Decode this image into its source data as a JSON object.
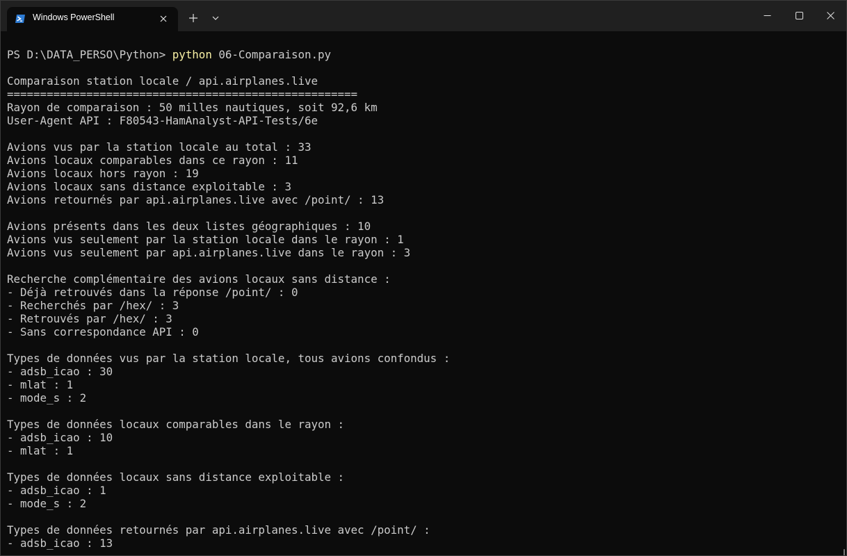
{
  "window": {
    "tab_title": "Windows PowerShell",
    "icons": {
      "tab": "powershell-icon",
      "close_tab": "close-icon",
      "new_tab": "plus-icon",
      "dropdown": "chevron-down-icon",
      "minimize": "minimize-icon",
      "maximize": "maximize-icon",
      "close": "close-icon"
    },
    "colors": {
      "titlebar": "#202020",
      "background": "#0c0c0c",
      "text": "#cccccc",
      "command": "#f9f1a5",
      "powershell_icon": "#2d7bd4"
    }
  },
  "terminal": {
    "prompt": "PS D:\\DATA_PERSO\\Python> ",
    "command": "python",
    "argument": " 06-Comparaison.py",
    "lines": [
      "",
      "Comparaison station locale / api.airplanes.live",
      "=====================================================",
      "Rayon de comparaison : 50 milles nautiques, soit 92,6 km",
      "User-Agent API : F80543-HamAnalyst-API-Tests/6e",
      "",
      "Avions vus par la station locale au total : 33",
      "Avions locaux comparables dans ce rayon : 11",
      "Avions locaux hors rayon : 19",
      "Avions locaux sans distance exploitable : 3",
      "Avions retournés par api.airplanes.live avec /point/ : 13",
      "",
      "Avions présents dans les deux listes géographiques : 10",
      "Avions vus seulement par la station locale dans le rayon : 1",
      "Avions vus seulement par api.airplanes.live dans le rayon : 3",
      "",
      "Recherche complémentaire des avions locaux sans distance :",
      "- Déjà retrouvés dans la réponse /point/ : 0",
      "- Recherchés par /hex/ : 3",
      "- Retrouvés par /hex/ : 3",
      "- Sans correspondance API : 0",
      "",
      "Types de données vus par la station locale, tous avions confondus :",
      "- adsb_icao : 30",
      "- mlat : 1",
      "- mode_s : 2",
      "",
      "Types de données locaux comparables dans le rayon :",
      "- adsb_icao : 10",
      "- mlat : 1",
      "",
      "Types de données locaux sans distance exploitable :",
      "- adsb_icao : 1",
      "- mode_s : 2",
      "",
      "Types de données retournés par api.airplanes.live avec /point/ :",
      "- adsb_icao : 13"
    ]
  }
}
